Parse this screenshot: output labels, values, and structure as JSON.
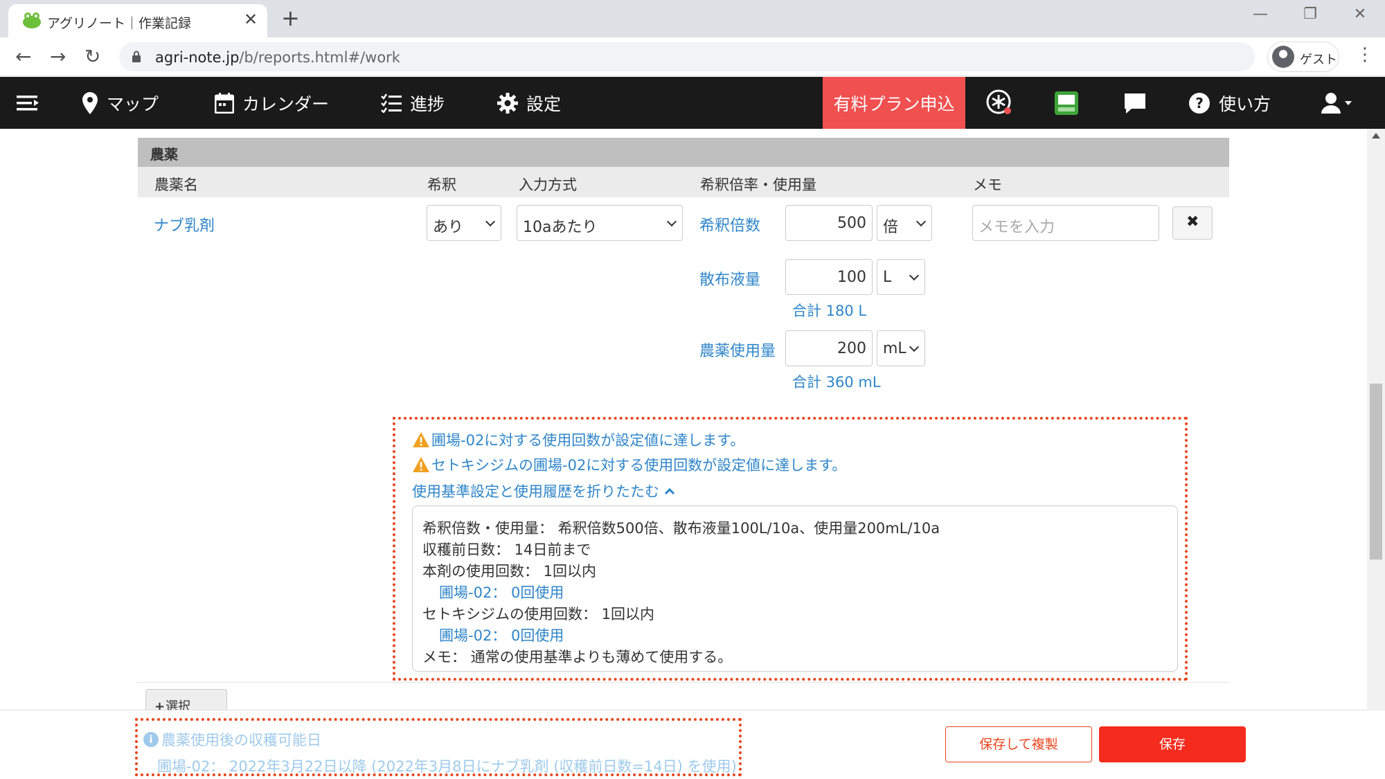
{
  "browser": {
    "tab_title": "アグリノート｜作業記録",
    "url_domain": "agri-note.jp",
    "url_path": "/b/reports.html#/work",
    "profile_label": "ゲスト",
    "minimize": "—",
    "restore": "❐",
    "close": "✕"
  },
  "header": {
    "nav": [
      "マップ",
      "カレンダー",
      "進捗",
      "設定"
    ],
    "plan_button": "有料プラン申込",
    "help": "使い方"
  },
  "pesticide": {
    "section_title": "農薬",
    "columns": [
      "農薬名",
      "希釈",
      "入力方式",
      "希釈倍率・使用量",
      "メモ"
    ],
    "name": "ナブ乳剤",
    "dilution": "あり",
    "input_mode": "10aあたり",
    "rows": [
      {
        "label": "希釈倍数",
        "value": "500",
        "unit": "倍",
        "total": ""
      },
      {
        "label": "散布液量",
        "value": "100",
        "unit": "L",
        "total": "合計 180 L"
      },
      {
        "label": "農薬使用量",
        "value": "200",
        "unit": "mL",
        "total": "合計 360 mL"
      }
    ],
    "memo_placeholder": "メモを入力",
    "delete_icon": "✖"
  },
  "warnings": {
    "items": [
      "圃場-02に対する使用回数が設定値に達します。",
      "セトキシジムの圃場-02に対する使用回数が設定値に達します。"
    ],
    "fold_label": "使用基準設定と使用履歴を折りたたむ",
    "info_lines": [
      {
        "text": "希釈倍数・使用量： 希釈倍数500倍、散布液量100L/10a、使用量200mL/10a",
        "sub": false
      },
      {
        "text": "収穫前日数： 14日前まで",
        "sub": false
      },
      {
        "text": "本剤の使用回数： 1回以内",
        "sub": false
      },
      {
        "text": "圃場-02： 0回使用",
        "sub": true
      },
      {
        "text": "セトキシジムの使用回数： 1回以内",
        "sub": false
      },
      {
        "text": "圃場-02： 0回使用",
        "sub": true
      },
      {
        "text": "メモ： 通常の使用基準よりも薄めて使用する。",
        "sub": false
      }
    ]
  },
  "add_button": "選択",
  "footer": {
    "harvest_title": "農薬使用後の収穫可能日",
    "harvest_line": "圃場-02： 2022年3月22日以降 (2022年3月8日にナブ乳剤 (収穫前日数=14日) を使用)",
    "copy_button": "保存して複製",
    "save_button": "保存"
  },
  "colors": {
    "accent_blue": "#2f86c9",
    "plan_red": "#f05050",
    "save_red": "#f52b1e",
    "warning_orange": "#f0a020",
    "highlight_dotted": "#e8441c"
  }
}
